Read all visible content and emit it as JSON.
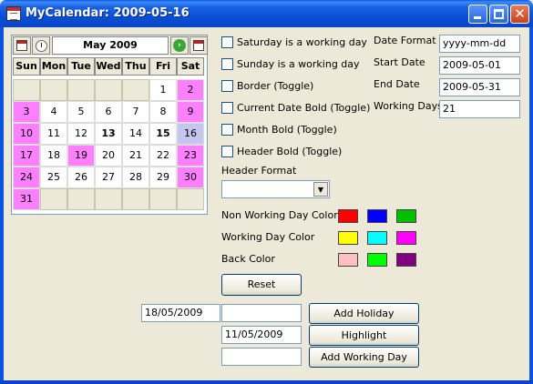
{
  "window": {
    "title": "MyCalendar: 2009-05-16"
  },
  "calendar": {
    "month_title": "May 2009",
    "day_headers": [
      "Sun",
      "Mon",
      "Tue",
      "Wed",
      "Thu",
      "Fri",
      "Sat"
    ],
    "weeks": [
      [
        {
          "d": "",
          "s": "blank"
        },
        {
          "d": "",
          "s": "blank"
        },
        {
          "d": "",
          "s": "blank"
        },
        {
          "d": "",
          "s": "blank"
        },
        {
          "d": "",
          "s": "blank"
        },
        {
          "d": "1",
          "s": ""
        },
        {
          "d": "2",
          "s": "nw"
        }
      ],
      [
        {
          "d": "3",
          "s": "nw"
        },
        {
          "d": "4",
          "s": ""
        },
        {
          "d": "5",
          "s": ""
        },
        {
          "d": "6",
          "s": ""
        },
        {
          "d": "7",
          "s": ""
        },
        {
          "d": "8",
          "s": ""
        },
        {
          "d": "9",
          "s": "nw"
        }
      ],
      [
        {
          "d": "10",
          "s": "nw"
        },
        {
          "d": "11",
          "s": ""
        },
        {
          "d": "12",
          "s": ""
        },
        {
          "d": "13",
          "s": "bold"
        },
        {
          "d": "14",
          "s": ""
        },
        {
          "d": "15",
          "s": "bold"
        },
        {
          "d": "16",
          "s": "hl"
        }
      ],
      [
        {
          "d": "17",
          "s": "nw"
        },
        {
          "d": "18",
          "s": ""
        },
        {
          "d": "19",
          "s": "hol"
        },
        {
          "d": "20",
          "s": ""
        },
        {
          "d": "21",
          "s": ""
        },
        {
          "d": "22",
          "s": ""
        },
        {
          "d": "23",
          "s": "nw"
        }
      ],
      [
        {
          "d": "24",
          "s": "nw"
        },
        {
          "d": "25",
          "s": ""
        },
        {
          "d": "26",
          "s": ""
        },
        {
          "d": "27",
          "s": ""
        },
        {
          "d": "28",
          "s": ""
        },
        {
          "d": "29",
          "s": ""
        },
        {
          "d": "30",
          "s": "nw"
        }
      ],
      [
        {
          "d": "31",
          "s": "nw"
        },
        {
          "d": "",
          "s": "blank"
        },
        {
          "d": "",
          "s": "blank"
        },
        {
          "d": "",
          "s": "blank"
        },
        {
          "d": "",
          "s": "blank"
        },
        {
          "d": "",
          "s": "blank"
        },
        {
          "d": "",
          "s": "blank"
        }
      ]
    ]
  },
  "options": {
    "saturday": "Saturday is a working day",
    "sunday": "Sunday is a working day",
    "border": "Border (Toggle)",
    "current_date_bold": "Current Date Bold (Toggle)",
    "month_bold": "Month Bold (Toggle)",
    "header_bold": "Header Bold (Toggle)"
  },
  "fields": {
    "date_format_label": "Date Format",
    "date_format_value": "yyyy-mm-dd",
    "start_date_label": "Start Date",
    "start_date_value": "2009-05-01",
    "end_date_label": "End Date",
    "end_date_value": "2009-05-31",
    "working_days_label": "Working Days",
    "working_days_value": "21"
  },
  "header_format": {
    "label": "Header Format",
    "value": ""
  },
  "colors": {
    "non_working_label": "Non Working Day Color",
    "non_working": [
      "#ff0000",
      "#0000ff",
      "#00c000"
    ],
    "working_label": "Working Day Color",
    "working": [
      "#ffff00",
      "#00ffff",
      "#ff00ff"
    ],
    "back_label": "Back Color",
    "back": [
      "#ffc0c0",
      "#00ff00",
      "#800080"
    ],
    "non_working_day_cell": "#ff80ff",
    "highlight_cell": "#c4c6f0"
  },
  "buttons": {
    "reset": "Reset",
    "add_holiday": "Add Holiday",
    "highlight": "Highlight",
    "add_working_day": "Add Working Day"
  },
  "inputs": {
    "holiday_date": "18/05/2009",
    "holiday_desc": "",
    "highlight_date": "11/05/2009",
    "working_day_date": ""
  }
}
